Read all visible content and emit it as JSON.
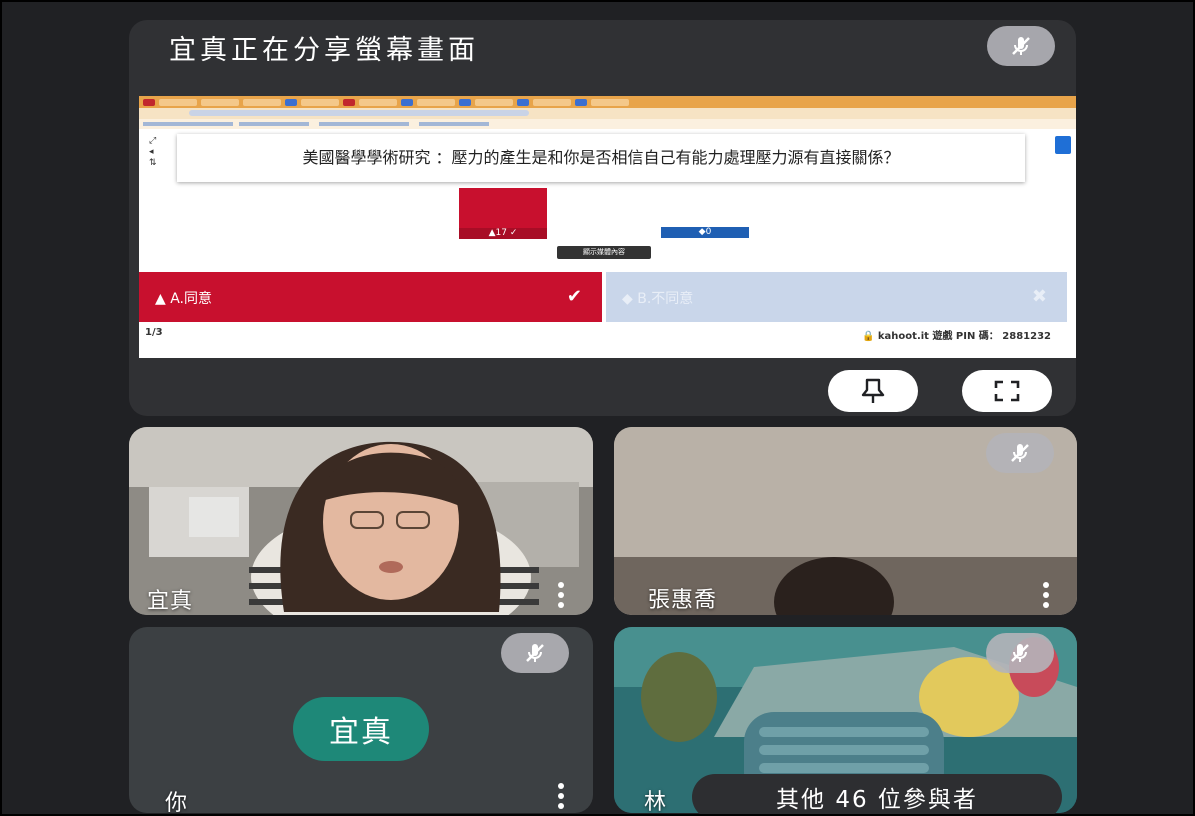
{
  "share": {
    "title": "宜真正在分享螢幕畫面",
    "question": "美國醫學學術研究 ：壓力的產生是和你是否相信自己有能力處理壓力源有直接關係？",
    "bar_a_label": "▲17 ✓",
    "bar_b_label": "◆0",
    "show_media_label": "顯示媒體內容",
    "answer_a": "▲ A.同意",
    "answer_a_mark": "✔",
    "answer_b": "◆ B.不同意",
    "answer_b_mark": "✖",
    "page_counter": "1/3",
    "pin_text": "🔒 kahoot.it 遊戲 PIN 碼： 2881232",
    "side_controls": [
      "⤢",
      "◂",
      "⇅"
    ],
    "colors": {
      "answer_a": "#c8102e",
      "answer_b": "#c9d6ea",
      "bar_b": "#1f5fb3"
    }
  },
  "share_controls": {
    "pin_icon": "pin-icon",
    "fullscreen_icon": "fullscreen-icon"
  },
  "participants": [
    {
      "name": "宜真"
    },
    {
      "name": "張惠喬"
    },
    {
      "name": "你",
      "avatar": "宜真"
    },
    {
      "name": "林"
    }
  ],
  "others_label": "其他 46 位參與者"
}
